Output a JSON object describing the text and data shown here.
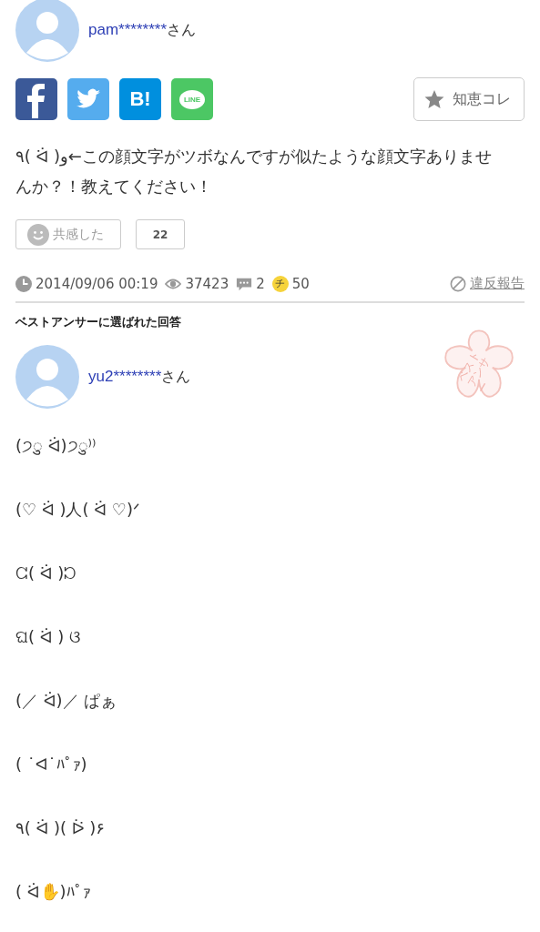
{
  "question": {
    "user": {
      "name": "pam********",
      "suffix": "さん"
    },
    "share": [
      {
        "kind": "facebook"
      },
      {
        "kind": "twitter"
      },
      {
        "kind": "hatena",
        "label": "B!"
      },
      {
        "kind": "line",
        "label": "LINE"
      }
    ],
    "collect_button": "知恵コレ",
    "text": "٩( ᐛ )و←この顔文字がツボなんですが似たような顔文字ありませんか？！教えてください！",
    "empathy": {
      "label": "共感した",
      "count": "22"
    },
    "meta": {
      "date": "2014/09/06 00:19",
      "views": "37423",
      "answers": "2",
      "coin": "チ",
      "coins": "50",
      "report": "違反報告"
    }
  },
  "best_answer": {
    "heading": "ベストアンサーに選ばれた回答",
    "stamp": "ベストアンサー",
    "user": {
      "name": "yu2********",
      "suffix": "さん"
    },
    "lines": [
      "(੭ु ᐛ)੭ु⁾⁾",
      "(♡ ᐛ )人( ᐛ ♡)ᐟ",
      "ᘳ( ᐛ )ᘰ",
      "ଘ( ᐛ ) ଓ",
      "(／ ᐛ)／ ぱぁ",
      "( ˙ᐊ˙ﾊﾟｧ)",
      "٩( ᐛ )( ᐖ )۶",
      "( ᐛ✋)ﾊﾟｧ"
    ]
  }
}
